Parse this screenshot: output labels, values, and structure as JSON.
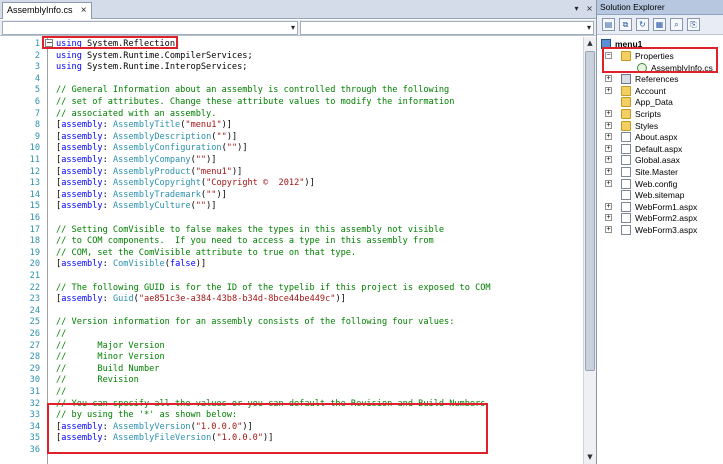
{
  "editor": {
    "tab_label": "AssemblyInfo.cs",
    "tab_close": "×",
    "tab_dropdown": "▾",
    "tab_close_all": "×",
    "nav_dropdown_arrow": "▾",
    "collapse_glyph": "−",
    "scroll_up": "▲",
    "scroll_down": "▼",
    "lines": [
      {
        "n": "1",
        "parts": [
          [
            "k",
            "using"
          ],
          [
            "",
            " System.Reflection;"
          ]
        ]
      },
      {
        "n": "2",
        "parts": [
          [
            "k",
            "using"
          ],
          [
            "",
            " System.Runtime.CompilerServices;"
          ]
        ]
      },
      {
        "n": "3",
        "parts": [
          [
            "k",
            "using"
          ],
          [
            "",
            " System.Runtime.InteropServices;"
          ]
        ]
      },
      {
        "n": "4",
        "parts": []
      },
      {
        "n": "5",
        "parts": [
          [
            "c",
            "// General Information about an assembly is controlled through the following"
          ]
        ]
      },
      {
        "n": "6",
        "parts": [
          [
            "c",
            "// set of attributes. Change these attribute values to modify the information"
          ]
        ]
      },
      {
        "n": "7",
        "parts": [
          [
            "c",
            "// associated with an assembly."
          ]
        ]
      },
      {
        "n": "8",
        "parts": [
          [
            "",
            "["
          ],
          [
            "k",
            "assembly"
          ],
          [
            "",
            ": "
          ],
          [
            "t",
            "AssemblyTitle"
          ],
          [
            "",
            "("
          ],
          [
            "s",
            "\"menu1\""
          ],
          [
            "",
            ")]"
          ]
        ]
      },
      {
        "n": "9",
        "parts": [
          [
            "",
            "["
          ],
          [
            "k",
            "assembly"
          ],
          [
            "",
            ": "
          ],
          [
            "t",
            "AssemblyDescription"
          ],
          [
            "",
            "("
          ],
          [
            "s",
            "\"\""
          ],
          [
            "",
            ")]"
          ]
        ]
      },
      {
        "n": "10",
        "parts": [
          [
            "",
            "["
          ],
          [
            "k",
            "assembly"
          ],
          [
            "",
            ": "
          ],
          [
            "t",
            "AssemblyConfiguration"
          ],
          [
            "",
            "("
          ],
          [
            "s",
            "\"\""
          ],
          [
            "",
            ")]"
          ]
        ]
      },
      {
        "n": "11",
        "parts": [
          [
            "",
            "["
          ],
          [
            "k",
            "assembly"
          ],
          [
            "",
            ": "
          ],
          [
            "t",
            "AssemblyCompany"
          ],
          [
            "",
            "("
          ],
          [
            "s",
            "\"\""
          ],
          [
            "",
            ")]"
          ]
        ]
      },
      {
        "n": "12",
        "parts": [
          [
            "",
            "["
          ],
          [
            "k",
            "assembly"
          ],
          [
            "",
            ": "
          ],
          [
            "t",
            "AssemblyProduct"
          ],
          [
            "",
            "("
          ],
          [
            "s",
            "\"menu1\""
          ],
          [
            "",
            ")]"
          ]
        ]
      },
      {
        "n": "13",
        "parts": [
          [
            "",
            "["
          ],
          [
            "k",
            "assembly"
          ],
          [
            "",
            ": "
          ],
          [
            "t",
            "AssemblyCopyright"
          ],
          [
            "",
            "("
          ],
          [
            "s",
            "\"Copyright ©  2012\""
          ],
          [
            "",
            ")]"
          ]
        ]
      },
      {
        "n": "14",
        "parts": [
          [
            "",
            "["
          ],
          [
            "k",
            "assembly"
          ],
          [
            "",
            ": "
          ],
          [
            "t",
            "AssemblyTrademark"
          ],
          [
            "",
            "("
          ],
          [
            "s",
            "\"\""
          ],
          [
            "",
            ")]"
          ]
        ]
      },
      {
        "n": "15",
        "parts": [
          [
            "",
            "["
          ],
          [
            "k",
            "assembly"
          ],
          [
            "",
            ": "
          ],
          [
            "t",
            "AssemblyCulture"
          ],
          [
            "",
            "("
          ],
          [
            "s",
            "\"\""
          ],
          [
            "",
            ")]"
          ]
        ]
      },
      {
        "n": "16",
        "parts": []
      },
      {
        "n": "17",
        "parts": [
          [
            "c",
            "// Setting ComVisible to false makes the types in this assembly not visible"
          ]
        ]
      },
      {
        "n": "18",
        "parts": [
          [
            "c",
            "// to COM components.  If you need to access a type in this assembly from"
          ]
        ]
      },
      {
        "n": "19",
        "parts": [
          [
            "c",
            "// COM, set the ComVisible attribute to true on that type."
          ]
        ]
      },
      {
        "n": "20",
        "parts": [
          [
            "",
            "["
          ],
          [
            "k",
            "assembly"
          ],
          [
            "",
            ": "
          ],
          [
            "t",
            "ComVisible"
          ],
          [
            "",
            "("
          ],
          [
            "k",
            "false"
          ],
          [
            "",
            ")]"
          ]
        ]
      },
      {
        "n": "21",
        "parts": []
      },
      {
        "n": "22",
        "parts": [
          [
            "c",
            "// The following GUID is for the ID of the typelib if this project is exposed to COM"
          ]
        ]
      },
      {
        "n": "23",
        "parts": [
          [
            "",
            "["
          ],
          [
            "k",
            "assembly"
          ],
          [
            "",
            ": "
          ],
          [
            "t",
            "Guid"
          ],
          [
            "",
            "("
          ],
          [
            "s",
            "\"ae851c3e-a384-43b8-b34d-8bce44be449c\""
          ],
          [
            "",
            ")]"
          ]
        ]
      },
      {
        "n": "24",
        "parts": []
      },
      {
        "n": "25",
        "parts": [
          [
            "c",
            "// Version information for an assembly consists of the following four values:"
          ]
        ]
      },
      {
        "n": "26",
        "parts": [
          [
            "c",
            "//"
          ]
        ]
      },
      {
        "n": "27",
        "parts": [
          [
            "c",
            "//      Major Version"
          ]
        ]
      },
      {
        "n": "28",
        "parts": [
          [
            "c",
            "//      Minor Version"
          ]
        ]
      },
      {
        "n": "29",
        "parts": [
          [
            "c",
            "//      Build Number"
          ]
        ]
      },
      {
        "n": "30",
        "parts": [
          [
            "c",
            "//      Revision"
          ]
        ]
      },
      {
        "n": "31",
        "parts": [
          [
            "c",
            "//"
          ]
        ]
      },
      {
        "n": "32",
        "parts": [
          [
            "c",
            "// You can specify all the values or you can default the Revision and Build Numbers"
          ]
        ]
      },
      {
        "n": "33",
        "parts": [
          [
            "c",
            "// by using the '*' as shown below:"
          ]
        ]
      },
      {
        "n": "34",
        "parts": [
          [
            "",
            "["
          ],
          [
            "k",
            "assembly"
          ],
          [
            "",
            ": "
          ],
          [
            "t",
            "AssemblyVersion"
          ],
          [
            "",
            "("
          ],
          [
            "s",
            "\"1.0.0.0\""
          ],
          [
            "",
            ")]"
          ]
        ]
      },
      {
        "n": "35",
        "parts": [
          [
            "",
            "["
          ],
          [
            "k",
            "assembly"
          ],
          [
            "",
            ": "
          ],
          [
            "t",
            "AssemblyFileVersion"
          ],
          [
            "",
            "("
          ],
          [
            "s",
            "\"1.0.0.0\""
          ],
          [
            "",
            ")]"
          ]
        ]
      },
      {
        "n": "36",
        "parts": []
      }
    ]
  },
  "solution_explorer": {
    "title": "Solution Explorer",
    "toolbar_icons": [
      "properties-icon",
      "show-all-files-icon",
      "refresh-icon",
      "nest-related-files-icon",
      "view-designer-icon",
      "copy-website-icon"
    ],
    "toolbar_glyphs": [
      "▤",
      "⧉",
      "↻",
      "▦",
      "⌕",
      "⎘"
    ],
    "project": "menu1",
    "items": [
      {
        "label": "Properties",
        "icon": "folder-icon",
        "level": 1,
        "expand": "−"
      },
      {
        "label": "AssemblyInfo.cs",
        "icon": "cs-file-icon",
        "level": 2,
        "expand": ""
      },
      {
        "label": "References",
        "icon": "references-icon",
        "level": 1,
        "expand": "+"
      },
      {
        "label": "Account",
        "icon": "folder-icon",
        "level": 1,
        "expand": "+"
      },
      {
        "label": "App_Data",
        "icon": "folder-icon",
        "level": 1,
        "expand": ""
      },
      {
        "label": "Scripts",
        "icon": "folder-icon",
        "level": 1,
        "expand": "+"
      },
      {
        "label": "Styles",
        "icon": "folder-icon",
        "level": 1,
        "expand": "+"
      },
      {
        "label": "About.aspx",
        "icon": "aspx-file-icon",
        "level": 1,
        "expand": "+"
      },
      {
        "label": "Default.aspx",
        "icon": "aspx-file-icon",
        "level": 1,
        "expand": "+"
      },
      {
        "label": "Global.asax",
        "icon": "asax-file-icon",
        "level": 1,
        "expand": "+"
      },
      {
        "label": "Site.Master",
        "icon": "master-file-icon",
        "level": 1,
        "expand": "+"
      },
      {
        "label": "Web.config",
        "icon": "config-file-icon",
        "level": 1,
        "expand": "+"
      },
      {
        "label": "Web.sitemap",
        "icon": "sitemap-file-icon",
        "level": 1,
        "expand": ""
      },
      {
        "label": "WebForm1.aspx",
        "icon": "aspx-file-icon",
        "level": 1,
        "expand": "+"
      },
      {
        "label": "WebForm2.aspx",
        "icon": "aspx-file-icon",
        "level": 1,
        "expand": "+"
      },
      {
        "label": "WebForm3.aspx",
        "icon": "aspx-file-icon",
        "level": 1,
        "expand": "+"
      }
    ]
  },
  "colors": {
    "keyword": "#0000ff",
    "type": "#2b91af",
    "string": "#a31515",
    "comment": "#008000",
    "highlight": "#e0202a"
  }
}
